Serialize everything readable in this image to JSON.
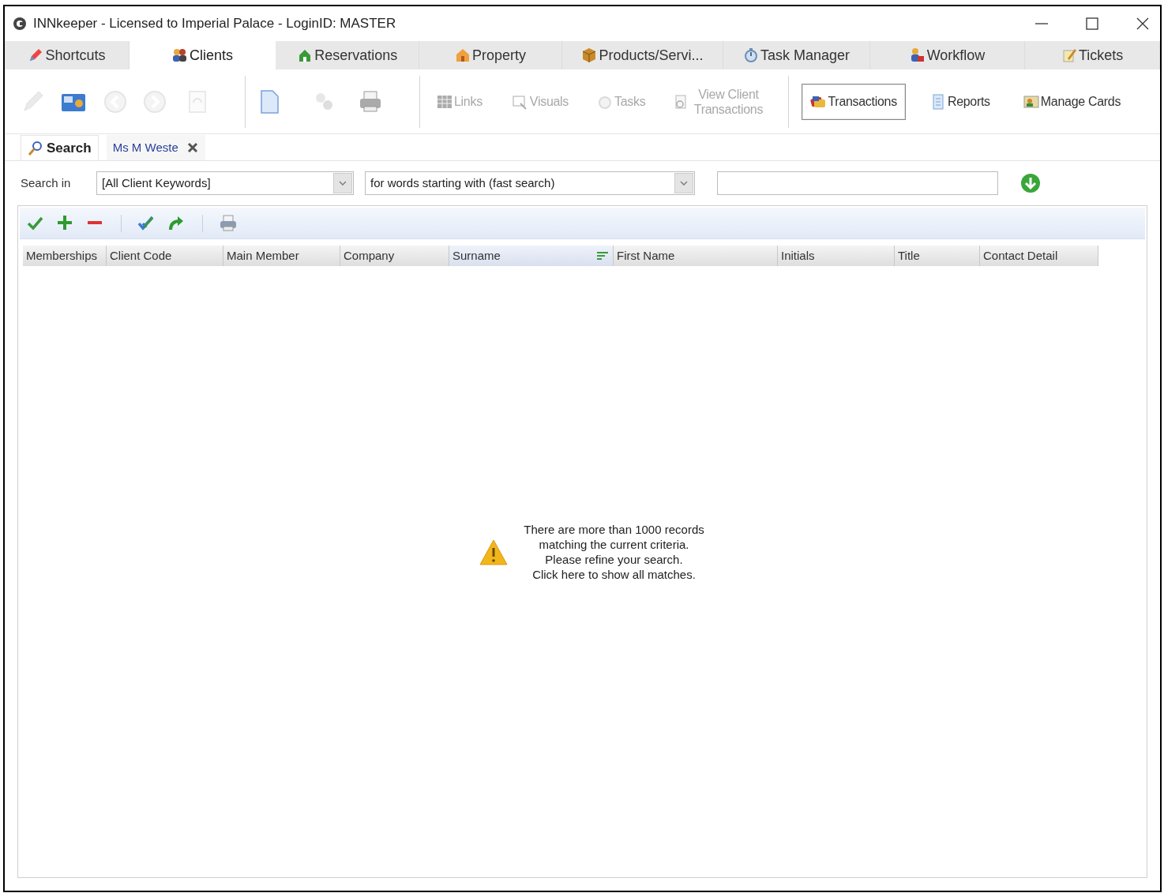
{
  "window": {
    "title": "INNkeeper - Licensed to Imperial Palace - LoginID: MASTER"
  },
  "tabs": [
    {
      "label": "Shortcuts",
      "selected": false
    },
    {
      "label": "Clients",
      "selected": true
    },
    {
      "label": "Reservations",
      "selected": false
    },
    {
      "label": "Property",
      "selected": false
    },
    {
      "label": "Products/Servi...",
      "selected": false
    },
    {
      "label": "Task Manager",
      "selected": false
    },
    {
      "label": "Workflow",
      "selected": false
    },
    {
      "label": "Tickets",
      "selected": false
    }
  ],
  "toolbar": {
    "icon_buttons": [
      {
        "disabled": true
      },
      {
        "disabled": false
      },
      {
        "disabled": true
      },
      {
        "disabled": true
      },
      {
        "disabled": true
      },
      {
        "disabled": false
      },
      {
        "disabled": true
      },
      {
        "disabled": false
      }
    ],
    "text_buttons": [
      {
        "label": "Links",
        "disabled": true,
        "selected": false
      },
      {
        "label": "Visuals",
        "disabled": true,
        "selected": false
      },
      {
        "label": "Tasks",
        "disabled": true,
        "selected": false
      },
      {
        "label": "View Client Transactions",
        "disabled": true,
        "selected": false
      },
      {
        "label": "Transactions",
        "disabled": false,
        "selected": true
      },
      {
        "label": "Reports",
        "disabled": false,
        "selected": false
      },
      {
        "label": "Manage Cards",
        "disabled": false,
        "selected": false
      }
    ]
  },
  "subtabs": [
    {
      "label": "Search",
      "selected": true
    },
    {
      "label": "Ms M Weste",
      "selected": false
    }
  ],
  "search": {
    "label": "Search in",
    "field": "[All Client Keywords]",
    "mode": "for words starting with (fast search)"
  },
  "grid": {
    "columns": [
      {
        "label": "Memberships",
        "sorted": false
      },
      {
        "label": "Client Code",
        "sorted": false
      },
      {
        "label": "Main Member",
        "sorted": false
      },
      {
        "label": "Company",
        "sorted": false
      },
      {
        "label": "Surname",
        "sorted": true
      },
      {
        "label": "First Name",
        "sorted": false
      },
      {
        "label": "Initials",
        "sorted": false
      },
      {
        "label": "Title",
        "sorted": false
      },
      {
        "label": "Contact Detail",
        "sorted": false
      }
    ],
    "message": {
      "lines": [
        "There are more than 1000 records",
        "matching the current criteria.",
        "Please refine your search."
      ],
      "link": "Click here to show all matches."
    }
  }
}
